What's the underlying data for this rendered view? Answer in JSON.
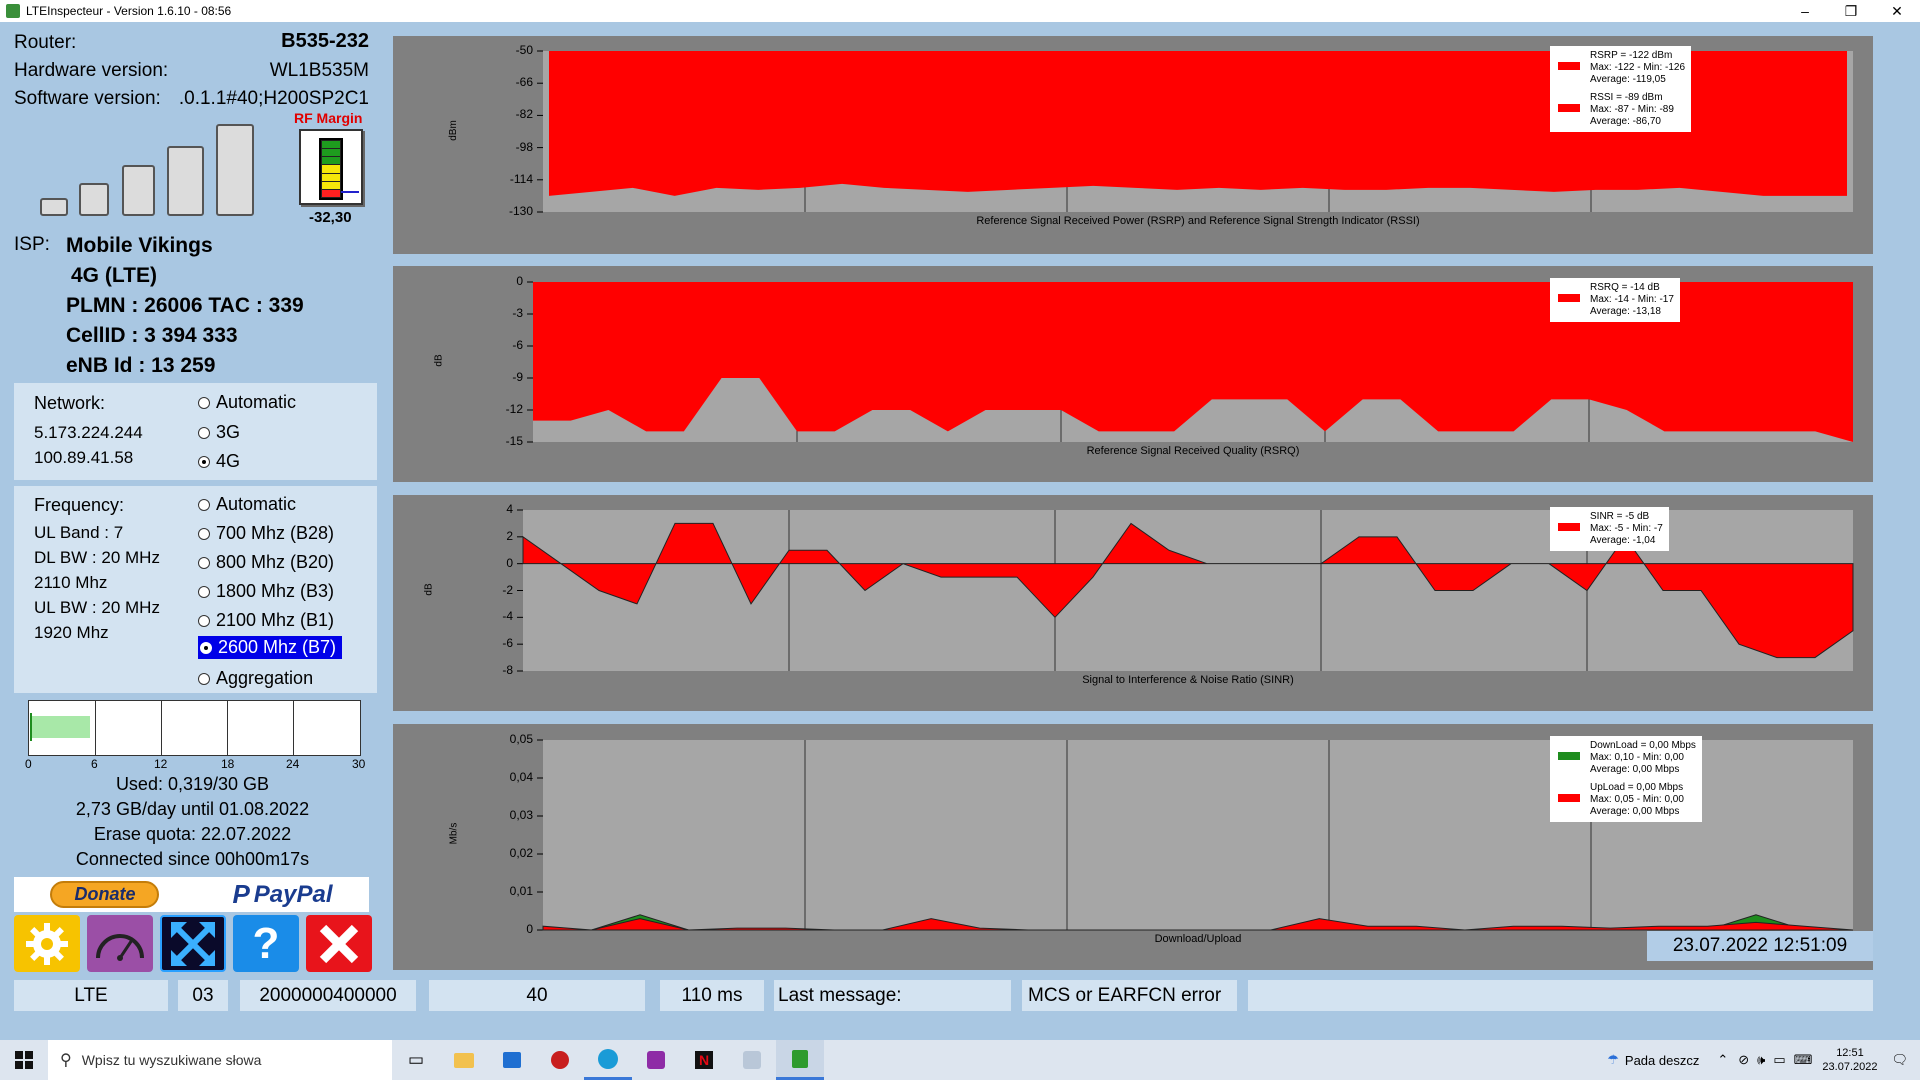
{
  "window": {
    "title": "LTEInspecteur - Version 1.6.10 - 08:56",
    "min": "–",
    "max": "❐",
    "close": "✕"
  },
  "device": {
    "router_label": "Router:",
    "router_value": "B535-232",
    "hw_label": "Hardware version:",
    "hw_value": "WL1B535M",
    "sw_label": "Software version:",
    "sw_value": ".0.1.1#40;H200SP2C1",
    "rf_margin_label": "RF Margin",
    "rf_margin_value": "-32,30",
    "signal_bars_lit": 0
  },
  "isp": {
    "label": "ISP:",
    "name": "Mobile Vikings",
    "tech": "4G (LTE)",
    "plmn": "PLMN : 26006 TAC : 339",
    "cellid": "CellID : 3 394 333",
    "enb": "eNB Id : 13 259"
  },
  "network": {
    "label": "Network:",
    "ip1": "5.173.224.244",
    "ip2": "100.89.41.58",
    "options": [
      "Automatic",
      "3G",
      "4G"
    ],
    "selected": 2
  },
  "frequency": {
    "label": "Frequency:",
    "ul_band": "UL Band : 7",
    "dl_bw": "DL BW : 20 MHz",
    "dl_freq": "2110 Mhz",
    "ul_bw": "UL BW : 20 MHz",
    "ul_freq": "1920 Mhz",
    "options": [
      "Automatic",
      "700 Mhz (B28)",
      "800 Mhz (B20)",
      "1800 Mhz (B3)",
      "2100 Mhz (B1)",
      "2600 Mhz (B7)",
      "Aggregation"
    ],
    "selected": 5
  },
  "usage": {
    "ticks": [
      "0",
      "6",
      "12",
      "18",
      "24",
      "30"
    ],
    "used_fraction": 0.011,
    "used": "Used: 0,319/30 GB",
    "per_day": "2,73 GB/day until 01.08.2022",
    "erase": "Erase quota: 22.07.2022",
    "connected": "Connected since 00h00m17s"
  },
  "donate": {
    "donate_label": "Donate",
    "paypal_label": "PayPal"
  },
  "chart_data": [
    {
      "type": "area",
      "title": "Reference Signal Received Power (RSRP) and Reference Signal Strength Indicator (RSSI)",
      "ylabel": "dBm",
      "ylim": [
        -130,
        -50
      ],
      "yticks": [
        "-50",
        "-66",
        "-82",
        "-98",
        "-114",
        "-130"
      ],
      "series": [
        {
          "name": "RSRP",
          "color": "#ff0000",
          "values": [
            -122,
            -120,
            -118,
            -122,
            -118,
            -119,
            -118,
            -116,
            -118,
            -119,
            -120,
            -119,
            -118,
            -117,
            -118,
            -119,
            -118,
            -119,
            -118,
            -119,
            -119,
            -118,
            -118,
            -119,
            -120,
            -119,
            -119,
            -118,
            -120,
            -122,
            -122,
            -122
          ]
        },
        {
          "name": "RSSI",
          "color": "#ff0000",
          "values": [
            -89,
            -88,
            -88,
            -87,
            -88,
            -87,
            -87,
            -87,
            -87,
            -87,
            -87,
            -86,
            -86,
            -86,
            -86,
            -86,
            -86,
            -86,
            -86,
            -87,
            -87,
            -86,
            -86,
            -86,
            -86,
            -87,
            -87,
            -86,
            -87,
            -87,
            -86,
            -87
          ]
        }
      ],
      "legend": [
        {
          "color": "#ff0000",
          "lines": [
            "RSRP = -122 dBm",
            "Max: -122 - Min: -126",
            "Average: -119,05"
          ]
        },
        {
          "color": "#ff0000",
          "lines": [
            "RSSI = -89 dBm",
            "Max: -87 - Min: -89",
            "Average: -86,70"
          ]
        }
      ]
    },
    {
      "type": "area",
      "title": "Reference Signal Received Quality (RSRQ)",
      "ylabel": "dB",
      "ylim": [
        -15,
        0
      ],
      "yticks": [
        "0",
        "-3",
        "-6",
        "-9",
        "-12",
        "-15"
      ],
      "series": [
        {
          "name": "RSRQ",
          "color": "#ff0000",
          "values": [
            -13,
            -13,
            -12,
            -14,
            -14,
            -9,
            -9,
            -14,
            -14,
            -12,
            -12,
            -14,
            -12,
            -12,
            -12,
            -14,
            -14,
            -14,
            -11,
            -11,
            -11,
            -14,
            -11,
            -11,
            -14,
            -14,
            -14,
            -11,
            -11,
            -12,
            -14,
            -14,
            -14,
            -14,
            -14,
            -15
          ]
        }
      ],
      "legend": [
        {
          "color": "#ff0000",
          "lines": [
            "RSRQ = -14 dB",
            "Max: -14 - Min: -17",
            "Average: -13,18"
          ]
        }
      ]
    },
    {
      "type": "area",
      "title": "Signal to Interference & Noise Ratio (SINR)",
      "ylabel": "dB",
      "ylim": [
        -8,
        4
      ],
      "yticks": [
        "4",
        "2",
        "0",
        "-2",
        "-4",
        "-6",
        "-8"
      ],
      "series": [
        {
          "name": "SINR",
          "color": "#ff0000",
          "values": [
            2,
            0,
            -2,
            -3,
            3,
            3,
            -3,
            1,
            1,
            -2,
            0,
            -1,
            -1,
            -1,
            -4,
            -1,
            3,
            1,
            0,
            0,
            0,
            0,
            2,
            2,
            -2,
            -2,
            0,
            0,
            -2,
            2,
            -2,
            -2,
            -6,
            -7,
            -7,
            -5
          ]
        }
      ],
      "legend": [
        {
          "color": "#ff0000",
          "lines": [
            "SINR = -5 dB",
            "Max: -5 - Min: -7",
            "Average: -1,04"
          ]
        }
      ]
    },
    {
      "type": "area",
      "title": "Download/Upload",
      "ylabel": "Mb/s",
      "ylim": [
        0,
        0.05
      ],
      "yticks": [
        "0,05",
        "0,04",
        "0,03",
        "0,02",
        "0,01",
        "0"
      ],
      "series": [
        {
          "name": "DownLoad",
          "color": "#1e8c1e",
          "values": [
            0,
            0,
            0.004,
            0,
            0,
            0,
            0,
            0,
            0,
            0,
            0,
            0,
            0,
            0,
            0,
            0,
            0,
            0,
            0,
            0,
            0,
            0,
            0,
            0,
            0,
            0.004,
            0,
            0
          ]
        },
        {
          "name": "UpLoad",
          "color": "#ff0000",
          "values": [
            0.001,
            0,
            0.003,
            0,
            0.0005,
            0.0005,
            0,
            0,
            0.003,
            0.0005,
            0,
            0,
            0,
            0,
            0,
            0,
            0.003,
            0.001,
            0.001,
            0,
            0.001,
            0.001,
            0.0005,
            0.001,
            0.001,
            0.002,
            0.001,
            0
          ]
        }
      ],
      "legend": [
        {
          "color": "#1e8c1e",
          "lines": [
            "DownLoad = 0,00 Mbps",
            "Max: 0,10 - Min: 0,00",
            "Average: 0,00 Mbps"
          ]
        },
        {
          "color": "#ff0000",
          "lines": [
            "UpLoad = 0,00 Mbps",
            "Max: 0,05 - Min: 0,00",
            "Average: 0,00 Mbps"
          ]
        }
      ]
    }
  ],
  "clock": "23.07.2022 12:51:09",
  "statusbar": {
    "tech": "LTE",
    "code": "03",
    "id": "2000000400000",
    "num": "40",
    "latency": "110 ms",
    "last_message": "Last message:",
    "error": "MCS or EARFCN error"
  },
  "taskbar": {
    "search_placeholder": "Wpisz tu wyszukiwane słowa",
    "weather": "Pada deszcz",
    "time": "12:51",
    "date": "23.07.2022"
  }
}
